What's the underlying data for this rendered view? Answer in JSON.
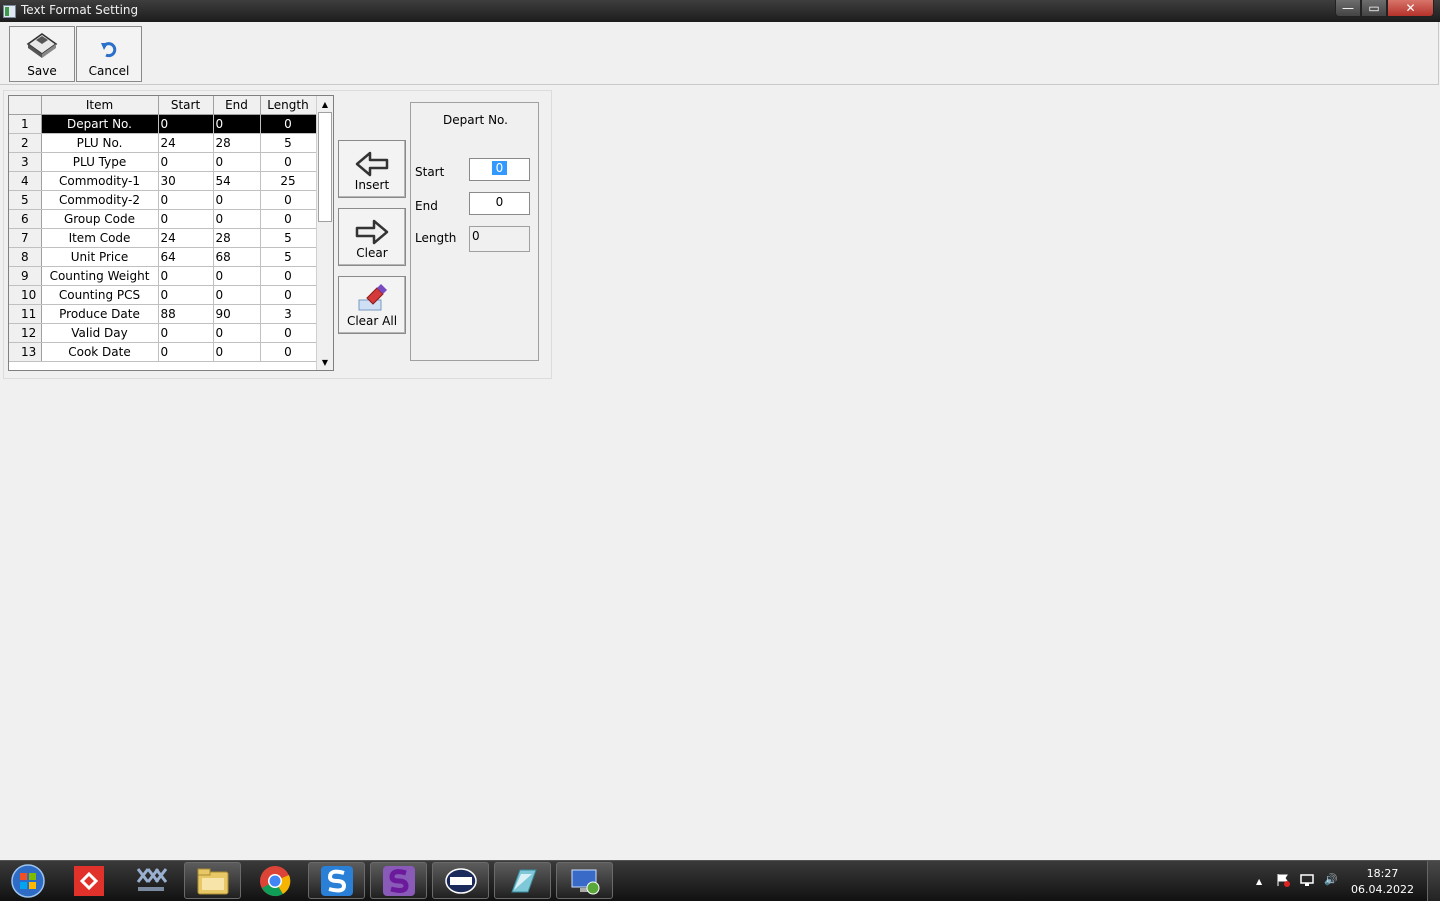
{
  "window": {
    "title": "Text Format Setting",
    "minimize_glyph": "—",
    "maximize_glyph": "▭",
    "close_glyph": "✕"
  },
  "toolbar": {
    "save_label": "Save",
    "cancel_label": "Cancel"
  },
  "grid": {
    "headers": [
      "Item",
      "Start",
      "End",
      "Length"
    ],
    "selected_row": 1,
    "rows": [
      {
        "no": "1",
        "item": "Depart No.",
        "start": "0",
        "end": "0",
        "length": "0"
      },
      {
        "no": "2",
        "item": "PLU No.",
        "start": "24",
        "end": "28",
        "length": "5"
      },
      {
        "no": "3",
        "item": "PLU Type",
        "start": "0",
        "end": "0",
        "length": "0"
      },
      {
        "no": "4",
        "item": "Commodity-1",
        "start": "30",
        "end": "54",
        "length": "25"
      },
      {
        "no": "5",
        "item": "Commodity-2",
        "start": "0",
        "end": "0",
        "length": "0"
      },
      {
        "no": "6",
        "item": "Group Code",
        "start": "0",
        "end": "0",
        "length": "0"
      },
      {
        "no": "7",
        "item": "Item Code",
        "start": "24",
        "end": "28",
        "length": "5"
      },
      {
        "no": "8",
        "item": "Unit Price",
        "start": "64",
        "end": "68",
        "length": "5"
      },
      {
        "no": "9",
        "item": "Counting Weight",
        "start": "0",
        "end": "0",
        "length": "0"
      },
      {
        "no": "10",
        "item": "Counting PCS",
        "start": "0",
        "end": "0",
        "length": "0"
      },
      {
        "no": "11",
        "item": "Produce Date",
        "start": "88",
        "end": "90",
        "length": "3"
      },
      {
        "no": "12",
        "item": "Valid Day",
        "start": "0",
        "end": "0",
        "length": "0"
      },
      {
        "no": "13",
        "item": "Cook Date",
        "start": "0",
        "end": "0",
        "length": "0"
      }
    ],
    "scroll_up_glyph": "▲",
    "scroll_down_glyph": "▼"
  },
  "actions": {
    "insert_label": "Insert",
    "clear_label": "Clear",
    "clear_all_label": "Clear All"
  },
  "detail": {
    "title": "Depart No.",
    "start_label": "Start",
    "start_value": "0",
    "end_label": "End",
    "end_value": "0",
    "length_label": "Length",
    "length_value": "0"
  },
  "taskbar": {
    "apps": [
      "start-orb",
      "app-red-icon",
      "respos-icon",
      "file-explorer-icon",
      "chrome-icon",
      "app-s-icon",
      "app-purple-s-icon",
      "densi-icon",
      "app-green-icon",
      "app-network-icon"
    ],
    "clock_time": "18:27",
    "clock_date": "06.04.2022",
    "tray_up_glyph": "▲",
    "tray_volume_glyph": "🔊"
  },
  "colors": {
    "selection_row": "#000000",
    "text_highlight": "#3399ff",
    "close_button": "#c2433a"
  }
}
